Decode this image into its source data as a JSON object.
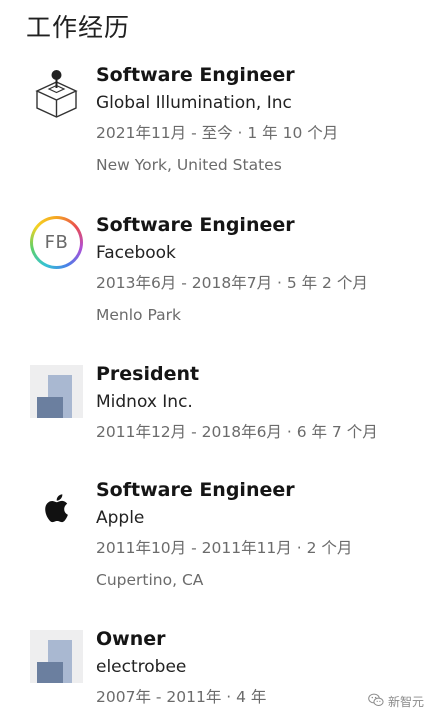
{
  "section": {
    "title": "工作经历"
  },
  "jobs": [
    {
      "role": "Software Engineer",
      "company": "Global Illumination, Inc",
      "dates": "2021年11月 - 至今 · 1 年 10 个月",
      "location": "New York, United States",
      "logo_icon": "global-illumination-logo"
    },
    {
      "role": "Software Engineer",
      "company": "Facebook",
      "dates": "2013年6月 - 2018年7月 · 5 年 2 个月",
      "location": "Menlo Park",
      "logo_icon": "facebook-logo",
      "logo_text": "FB"
    },
    {
      "role": "President",
      "company": "Midnox Inc.",
      "dates": "2011年12月 - 2018年6月 · 6 年 7 个月",
      "logo_icon": "company-placeholder-logo"
    },
    {
      "role": "Software Engineer",
      "company": "Apple",
      "dates": "2011年10月 - 2011年11月 · 2 个月",
      "location": "Cupertino, CA",
      "logo_icon": "apple-logo"
    },
    {
      "role": "Owner",
      "company": "electrobee",
      "dates": "2007年 - 2011年 · 4 年",
      "logo_icon": "company-placeholder-logo"
    }
  ],
  "watermark": {
    "text": "新智元",
    "icon": "wechat-icon"
  },
  "colors": {
    "placeholder_light": "#a9b8d1",
    "placeholder_dark": "#6b7f9f",
    "secondary_text": "#6b6b6b"
  }
}
